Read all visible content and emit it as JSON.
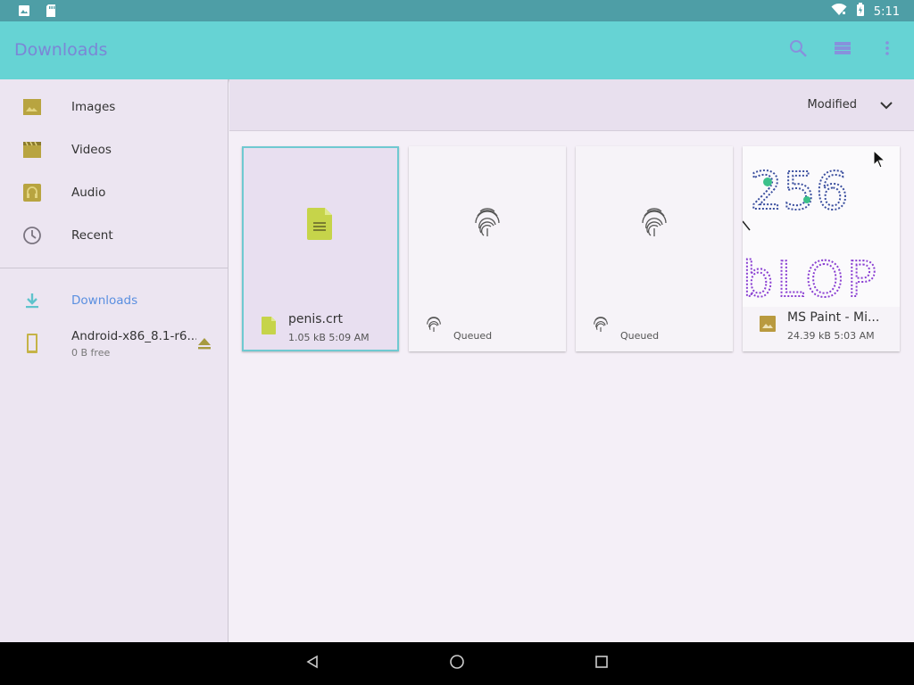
{
  "status": {
    "time": "5:11",
    "left_icons": [
      "notification-image-icon",
      "sd-card-icon"
    ],
    "right_icons": [
      "wifi-icon",
      "battery-icon"
    ]
  },
  "appbar": {
    "title": "Downloads",
    "actions": [
      "search-icon",
      "list-view-icon",
      "more-options-icon"
    ]
  },
  "sidebar": {
    "items": [
      {
        "label": "Images",
        "icon": "image-icon"
      },
      {
        "label": "Videos",
        "icon": "video-icon"
      },
      {
        "label": "Audio",
        "icon": "audio-icon"
      },
      {
        "label": "Recent",
        "icon": "clock-icon"
      }
    ],
    "roots": [
      {
        "label": "Downloads",
        "icon": "download-icon",
        "active": true
      }
    ],
    "drive": {
      "name": "Android-x86_8.1-r6...",
      "sub": "0 B free",
      "icon": "drive-icon"
    }
  },
  "sort": {
    "label": "Modified"
  },
  "files": [
    {
      "name": "penis.crt",
      "meta": "1.05 kB 5:09 AM",
      "type": "document",
      "selected": true
    },
    {
      "name": "",
      "meta": "Queued",
      "type": "fingerprint",
      "selected": false
    },
    {
      "name": "",
      "meta": "Queued",
      "type": "fingerprint",
      "selected": false
    },
    {
      "name": "MS Paint - Mi...",
      "meta": "24.39 kB 5:03 AM",
      "type": "image",
      "selected": false,
      "thumb_text_top": "256",
      "thumb_text_bottom": "bLOP"
    }
  ],
  "colors": {
    "statusbar": "#4e9ea6",
    "appbar": "#66d3d4",
    "title": "#7b86d6",
    "accent": "#5a8fe0",
    "doc_icon": "#c6d44a",
    "image_icon": "#b99a3f"
  }
}
